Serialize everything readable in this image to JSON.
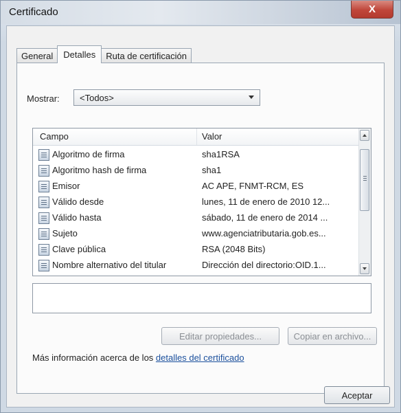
{
  "window": {
    "title": "Certificado",
    "close_label": "X"
  },
  "tabs": [
    {
      "label": "General",
      "active": false
    },
    {
      "label": "Detalles",
      "active": true
    },
    {
      "label": "Ruta de certificación",
      "active": false
    }
  ],
  "show": {
    "label": "Mostrar:",
    "selected": "<Todos>"
  },
  "list": {
    "columns": [
      "Campo",
      "Valor"
    ],
    "rows": [
      {
        "field": "Algoritmo de firma",
        "value": "sha1RSA"
      },
      {
        "field": "Algoritmo hash de firma",
        "value": "sha1"
      },
      {
        "field": "Emisor",
        "value": "AC APE, FNMT-RCM, ES"
      },
      {
        "field": "Válido desde",
        "value": "lunes, 11 de enero de 2010 12..."
      },
      {
        "field": "Válido hasta",
        "value": "sábado, 11 de enero de 2014 ..."
      },
      {
        "field": "Sujeto",
        "value": "www.agenciatributaria.gob.es..."
      },
      {
        "field": "Clave pública",
        "value": "RSA (2048 Bits)"
      },
      {
        "field": "Nombre alternativo del titular",
        "value": "Dirección del directorio:OID.1..."
      }
    ]
  },
  "detail_value": "",
  "buttons": {
    "edit": "Editar propiedades...",
    "copy": "Copiar en archivo...",
    "ok": "Aceptar"
  },
  "info": {
    "prefix": "Más información acerca de los ",
    "link": "detalles del certificado"
  }
}
